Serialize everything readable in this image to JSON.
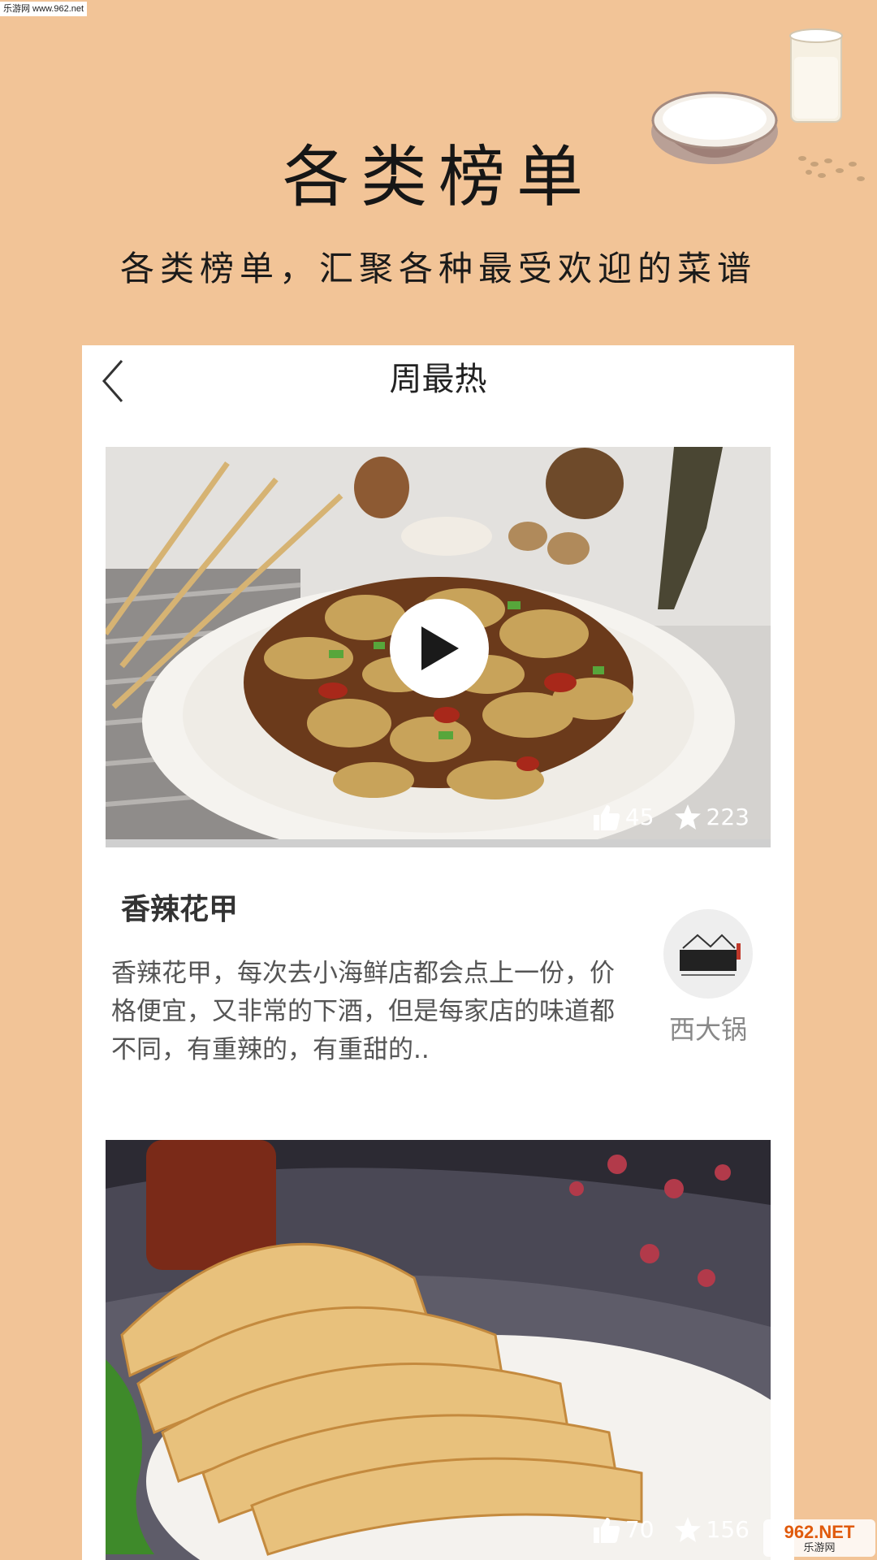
{
  "watermark": {
    "top_left": "乐游网 www.962.net",
    "bottom_right_main": "962.NET",
    "bottom_right_sub": "乐游网"
  },
  "promo": {
    "title": "各类榜单",
    "subtitle": "各类榜单，汇聚各种最受欢迎的菜谱"
  },
  "navbar": {
    "title": "周最热",
    "back_icon": "chevron-left-icon"
  },
  "recipes": [
    {
      "title": "香辣花甲",
      "description": "香辣花甲，每次去小海鲜店都会点上一份，价格便宜，又非常的下酒，但是每家店的味道都不同，有重辣的，有重甜的..",
      "likes": "45",
      "favorites": "223",
      "author": "西大锅",
      "has_video": true
    },
    {
      "likes": "70",
      "favorites": "156"
    }
  ],
  "colors": {
    "background": "#f2c497",
    "card": "#ffffff",
    "text_dark": "#222222",
    "text_muted": "#888888"
  },
  "icons": {
    "play": "play-icon",
    "like": "thumbs-up-icon",
    "favorite": "star-icon"
  }
}
